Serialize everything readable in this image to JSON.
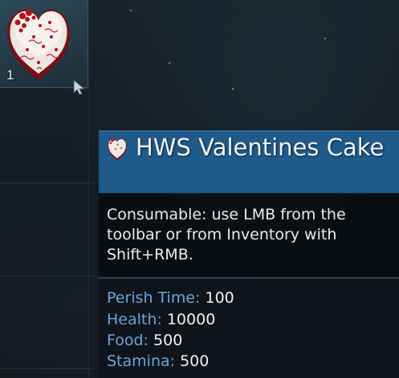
{
  "inventory": {
    "slot": {
      "count": "1",
      "item_icon": "heart-cake-icon"
    }
  },
  "tooltip": {
    "title": "HWS Valentines Cake",
    "header_color": "#1f5a8a",
    "description": "Consumable: use LMB from the toolbar or from Inventory with Shift+RMB.",
    "stats": [
      {
        "label": "Perish Time:",
        "value": "100"
      },
      {
        "label": "Health:",
        "value": "10000"
      },
      {
        "label": "Food:",
        "value": "500"
      },
      {
        "label": "Stamina:",
        "value": "500"
      }
    ]
  },
  "colors": {
    "stat_label": "#6aa5dd",
    "stat_value": "#eef2f6"
  }
}
